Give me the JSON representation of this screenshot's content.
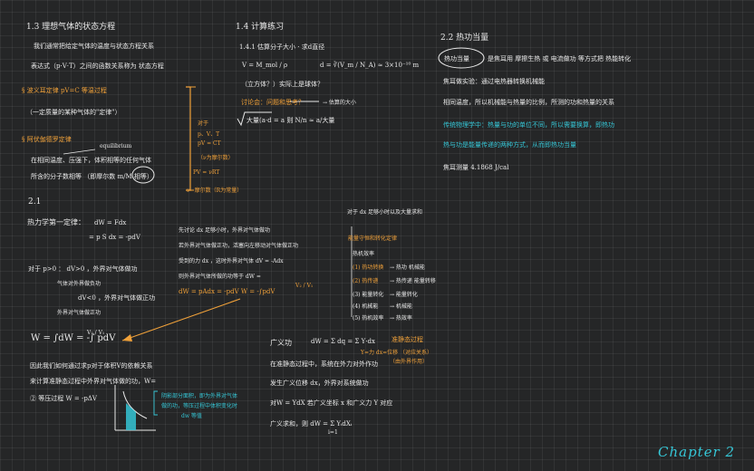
{
  "col1": {
    "h13": "1.3 理想气体的状态方程",
    "l1": "我们通常把给定气体的温度与状态方程关系",
    "l2": "表达式（p·V·T）之间的函数关系称为 状态方程",
    "boyle": "§ 波义耳定律  pV=C  等温过程",
    "boyle2": "（一定质量的某种气体的\"定律\"）",
    "avog": "§ 阿伏伽德罗定律",
    "avog_note": "equilibrium",
    "avog2": "在相同温度、压强下，体积相等的任何气体",
    "avog3": "所含的分子数相等    （即摩尔数  m/M  相等）",
    "bracket1": "对于",
    "bracket2": "p、V、T",
    "bracket3": "pV = CT",
    "bracket4": "（ν为摩尔数）",
    "bracket5": "PV = νRT",
    "bracket6": "ν=摩尔数（R为常量）",
    "h21": "2.1",
    "work_title": "热力学第一定律：",
    "work_eq1": "dW = Fdx",
    "work_eq2": "= p S dx = -pdV",
    "p_eq": "对于 p>0  ：   dV>0 ，外界对气体做功",
    "p_eq2": "气体对外界做负功",
    "p_eq3": "dV<0 ，外界对气体做正功",
    "p_eq4": "外界对气体做正功",
    "integral": "W = ∫dW = -∫ pdV",
    "integral_bounds": "V₂ / V₁",
    "final1": "因此我们如何通过求p对于体积V的依赖关系",
    "final2": "来计算准静态过程中外界对气体做的功，W=",
    "final3": "② 等压过程 W = -pΔV",
    "graph_note1": "阴影部分面积，即为外界对气体",
    "graph_note2": "做的功，等压过程中体积变化时",
    "graph_note3": "dw 等值"
  },
  "col2": {
    "h14": "1.4 计算练习",
    "l141": "1.4.1 估算分子大小 · 求d直径",
    "eq_v": "V = M_mol / ρ",
    "eq_d": "d = ∛(V_m / N_A) ≈ 3×10⁻¹⁰ m",
    "approx": "（立方体？）实际上是球体？",
    "question": "讨论会：问题和思考？",
    "q_ans": "→ 估算的大小",
    "cube_eq": "大量(a·d  =  a    则  N/n ≈ a/大量",
    "mid1": "先讨论 dx 足够小时，外界对气体做功",
    "mid2": "若外界对气体做正功，活塞向左移动对气体做正功",
    "mid3": "受到的力  dx ，这时外界对气体 dV = -Adx",
    "mid4": "则外界对气体所做的功等于 dW =",
    "mid5": "dW = pAdx = -pdV   W = -∫pdV",
    "mid_bounds": "V₂ / V₁"
  },
  "col3": {
    "h22": "2.2 热功当量",
    "circle": "热功当量",
    "l1": "是焦耳用 摩擦生热 或 电流做功 等方式把 热能转化",
    "l2": "焦耳做实验：通过电热器转换机械能",
    "l3": "相同温度，所以机械能与热量的比例，所测的功和热量的关系",
    "l4": "传统物理学中：热量与功的单位不同，所以需要换算，即热功",
    "l5": "热与功是能量传递的两种方式，从而即热功当量",
    "l6": "焦耳测量 4.1868 J/cal"
  },
  "col4": {
    "c1": "对于 dx 足够小时以及大量求和",
    "c2": "能量守恒和转化定律",
    "c3": "热机效率",
    "c4": "(1) 热功转换",
    "c5": "→ 热功 机械能",
    "c6": "(2) 热传递",
    "c7": "→ 热传递 能量转移",
    "c8": "(3) 能量转化",
    "c9": "→ 能量转化",
    "c10": "(4) 机械能",
    "c11": "→ 机械能",
    "c12": "(5) 热机效率",
    "c13": "→ 热效率"
  },
  "col5": {
    "gw": "广义功",
    "gw_eq": "dW = Σ dq = Σ Y·dx",
    "gw_note": "准静态过程",
    "gw_sub": "Y=力  dx=位移 （对应关系）",
    "gw_sub2": "（由外界作用）",
    "l1": "在准静态过程中，系统在外力对外作功",
    "l2": "发生广义位移 dx，外界对系统做功",
    "l3": "对W = YdX 若广义坐标 x 和广义力 Y 对应",
    "l4": "广义求和，则 dW = Σ YᵢdXᵢ",
    "sum_bounds": "i=1"
  },
  "signature": "Chapter 2"
}
